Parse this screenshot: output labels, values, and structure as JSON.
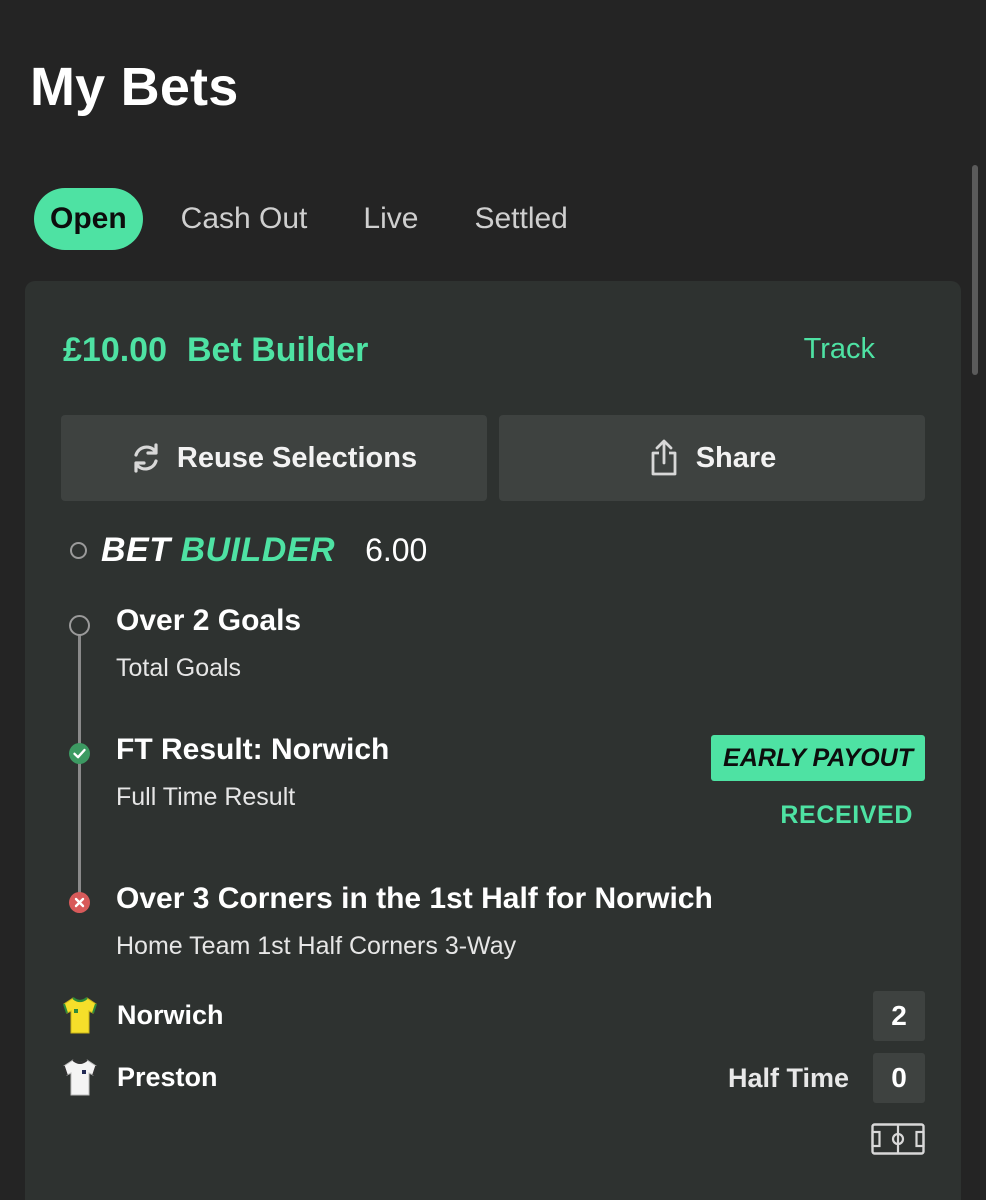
{
  "page": {
    "title": "My Bets"
  },
  "tabs": [
    {
      "label": "Open",
      "active": true
    },
    {
      "label": "Cash Out",
      "active": false
    },
    {
      "label": "Live",
      "active": false
    },
    {
      "label": "Settled",
      "active": false
    }
  ],
  "bet": {
    "stake": "£10.00",
    "bet_type": "Bet Builder",
    "track_label": "Track",
    "reuse_label": "Reuse Selections",
    "share_label": "Share",
    "builder_logo": {
      "part1": "BET",
      "part2": "BUILDER"
    },
    "odds": "6.00",
    "legs": [
      {
        "title": "Over 2 Goals",
        "subtitle": "Total Goals",
        "status": "open"
      },
      {
        "title": "FT Result: Norwich",
        "subtitle": "Full Time Result",
        "status": "won"
      },
      {
        "title": "Over 3 Corners in the 1st Half for Norwich",
        "subtitle": "Home Team 1st Half Corners 3-Way",
        "status": "lost"
      }
    ],
    "early_payout_badge": "EARLY PAYOUT",
    "received_label": "RECEIVED"
  },
  "match": {
    "home": {
      "name": "Norwich",
      "score": "2"
    },
    "away": {
      "name": "Preston",
      "score": "0"
    },
    "status": "Half Time"
  },
  "colors": {
    "accent": "#4ee2a3",
    "background": "#242424",
    "card": "#2e3230",
    "button": "#3e4240",
    "win": "#3c9a62",
    "lose": "#d85a5a"
  },
  "icons": {
    "reuse": "refresh-icon",
    "share": "share-icon",
    "home_kit": "yellow-shirt-icon",
    "away_kit": "white-shirt-icon",
    "pitch": "pitch-icon"
  }
}
